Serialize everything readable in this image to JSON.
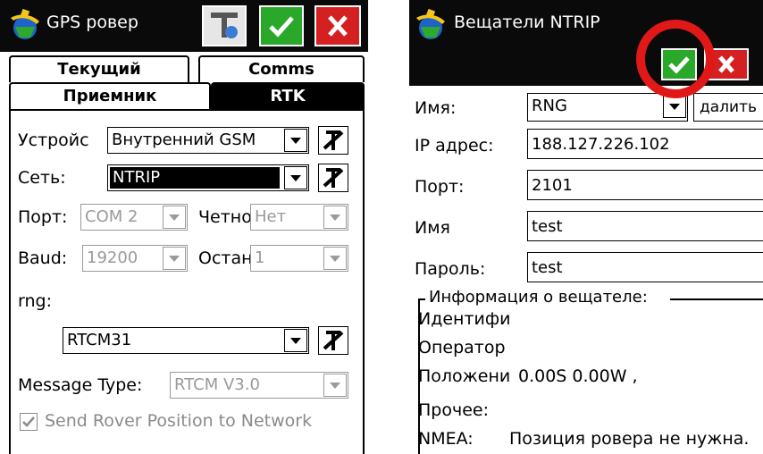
{
  "left": {
    "title": "GPS ровер",
    "tabs": [
      "Текущий",
      "Comms",
      "Приемник",
      "RTK"
    ],
    "fields": {
      "device_label": "Устройс",
      "device_value": "Внутренний GSM",
      "network_label": "Сеть:",
      "network_value": "NTRIP",
      "port_label": "Порт:",
      "port_value": "COM 2",
      "parity_label": "Четнос",
      "parity_value": "Нет",
      "baud_label": "Baud:",
      "baud_value": "19200",
      "stop_label": "Остан",
      "stop_value": "1",
      "rng_label": "rng:",
      "rng_value": "RTCM31",
      "message_type_label": "Message Type:",
      "message_type_value": "RTCM V3.0",
      "send_rover_label": "Send Rover Position to Network"
    },
    "send_rover_checked": true
  },
  "right": {
    "title": "Вещатели NTRIP",
    "fields": {
      "name_label": "Имя:",
      "name_value": "RNG",
      "delete_label": "далить",
      "ip_label": "IP адрес:",
      "ip_value": "188.127.226.102",
      "port_label": "Порт:",
      "port_value": "2101",
      "user_label": "Имя",
      "user_value": "test",
      "password_label": "Пароль:",
      "password_value": "test"
    },
    "info": {
      "header": "Информация о вещателе:",
      "identifier": "Идентифи",
      "operator": "Оператор",
      "position_label": "Положени",
      "position_value": "0.00S 0.00W ,",
      "other": "Прочее:",
      "nmea_label": "NMEA:",
      "nmea_value": "Позиция ровера не нужна."
    }
  },
  "colors": {
    "titlebar": "#0a0a0a",
    "ok_green": "#2aa82a",
    "cancel_red": "#d42020",
    "highlight_ring": "#e01818",
    "disabled_text": "#8a8a8a"
  },
  "icons": [
    "satellite-app-icon",
    "settings-tool-icon",
    "checkmark-icon",
    "close-icon",
    "tools-icon",
    "chevron-down-icon"
  ]
}
